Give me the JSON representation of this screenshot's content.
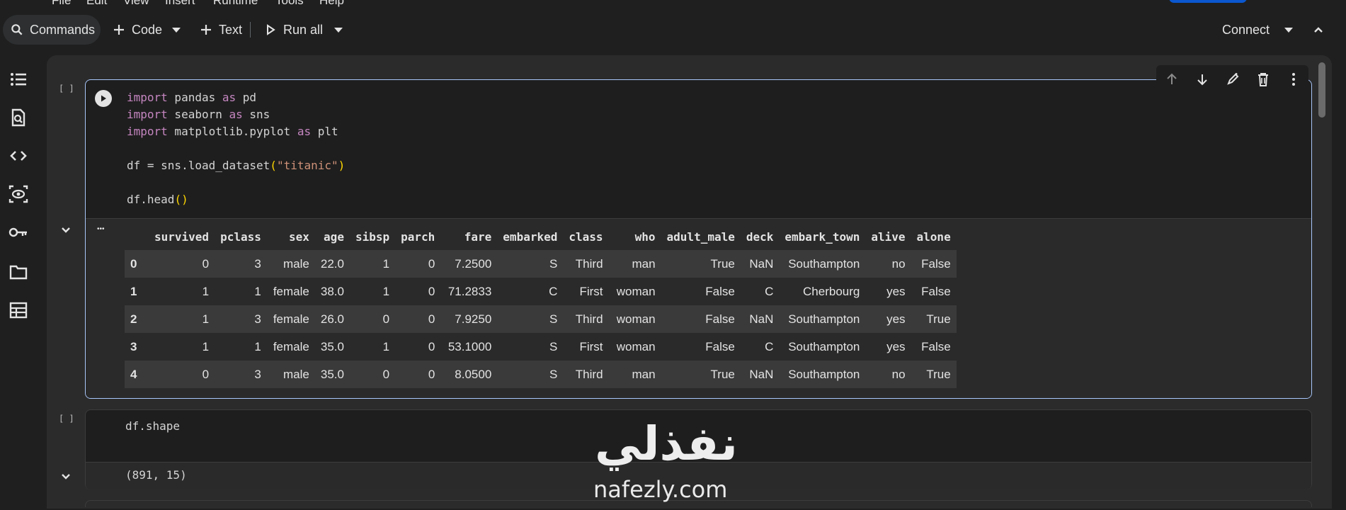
{
  "menubar": {
    "items": [
      "File",
      "Edit",
      "View",
      "Insert",
      "Runtime",
      "Tools",
      "Help"
    ]
  },
  "toolbar": {
    "commands": "Commands",
    "code": "Code",
    "text": "Text",
    "run_all": "Run all",
    "connect": "Connect"
  },
  "cell1": {
    "bracket": "[ ]",
    "output_dots": "•••",
    "code_lines": [
      {
        "kw1": "import",
        "rest": " pandas ",
        "kw2": "as",
        "tail": " pd"
      },
      {
        "kw1": "import",
        "rest": " seaborn ",
        "kw2": "as",
        "tail": " sns"
      },
      {
        "kw1": "import",
        "rest": " matplotlib.pyplot ",
        "kw2": "as",
        "tail": " plt"
      }
    ],
    "line4_pre": "df = sns.load_dataset",
    "line4_str": "\"titanic\"",
    "line5_pre": "df.head",
    "table": {
      "columns": [
        "",
        "survived",
        "pclass",
        "sex",
        "age",
        "sibsp",
        "parch",
        "fare",
        "embarked",
        "class",
        "who",
        "adult_male",
        "deck",
        "embark_town",
        "alive",
        "alone"
      ],
      "rows": [
        [
          "0",
          "0",
          "3",
          "male",
          "22.0",
          "1",
          "0",
          "7.2500",
          "S",
          "Third",
          "man",
          "True",
          "NaN",
          "Southampton",
          "no",
          "False"
        ],
        [
          "1",
          "1",
          "1",
          "female",
          "38.0",
          "1",
          "0",
          "71.2833",
          "C",
          "First",
          "woman",
          "False",
          "C",
          "Cherbourg",
          "yes",
          "False"
        ],
        [
          "2",
          "1",
          "3",
          "female",
          "26.0",
          "0",
          "0",
          "7.9250",
          "S",
          "Third",
          "woman",
          "False",
          "NaN",
          "Southampton",
          "yes",
          "True"
        ],
        [
          "3",
          "1",
          "1",
          "female",
          "35.0",
          "1",
          "0",
          "53.1000",
          "S",
          "First",
          "woman",
          "False",
          "C",
          "Southampton",
          "yes",
          "False"
        ],
        [
          "4",
          "0",
          "3",
          "male",
          "35.0",
          "0",
          "0",
          "8.0500",
          "S",
          "Third",
          "man",
          "True",
          "NaN",
          "Southampton",
          "no",
          "True"
        ]
      ]
    }
  },
  "cell2": {
    "bracket": "[ ]",
    "code": "df.shape",
    "output": "(891, 15)"
  },
  "watermark": {
    "arabic": "نفذلي",
    "latin": "nafezly.com"
  },
  "colors": {
    "accent": "#a8c7fa",
    "background": "#1f1f1f",
    "keyword": "#c586c0",
    "string": "#ce9178"
  }
}
